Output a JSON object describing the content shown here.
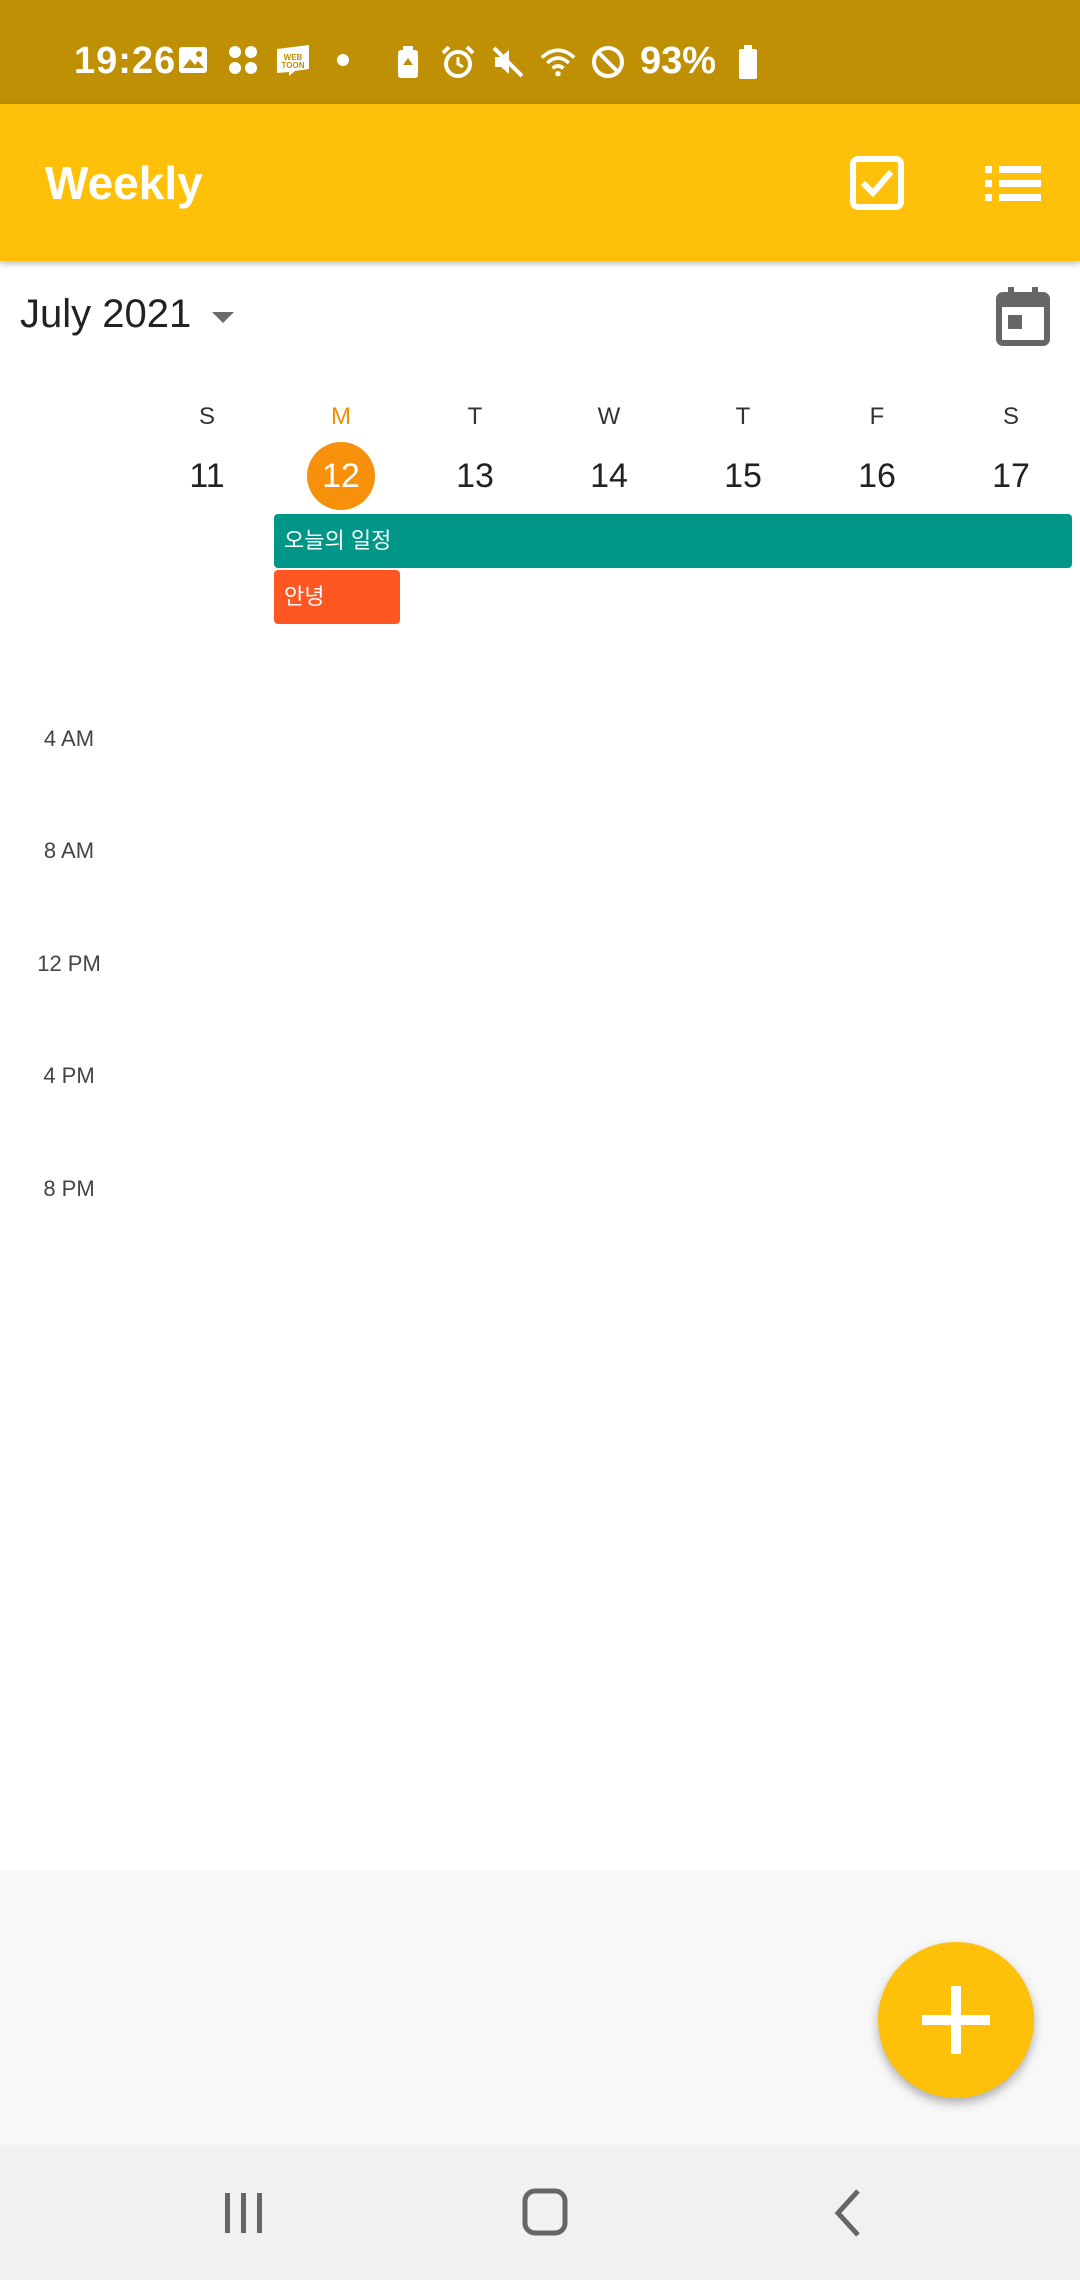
{
  "status_bar": {
    "time": "19:26",
    "battery": "93%",
    "icons": [
      "gallery-icon",
      "app-icon",
      "webtoon-icon",
      "dot-icon",
      "battery-saver-icon",
      "alarm-icon",
      "mute-icon",
      "wifi-icon",
      "do-not-disturb-icon",
      "battery-icon"
    ]
  },
  "app_bar": {
    "title": "Weekly",
    "actions": [
      "check-box-icon",
      "list-icon"
    ]
  },
  "header": {
    "month": "July 2021"
  },
  "week": {
    "days": [
      {
        "letter": "S",
        "number": "11"
      },
      {
        "letter": "M",
        "number": "12",
        "today": true
      },
      {
        "letter": "T",
        "number": "13"
      },
      {
        "letter": "W",
        "number": "14"
      },
      {
        "letter": "T",
        "number": "15"
      },
      {
        "letter": "F",
        "number": "16"
      },
      {
        "letter": "S",
        "number": "17"
      }
    ]
  },
  "events": [
    {
      "title": "오늘의 일정",
      "color": "#009688"
    },
    {
      "title": "안녕",
      "color": "#ff5722"
    }
  ],
  "time_labels": [
    "4 AM",
    "8 AM",
    "12 PM",
    "4 PM",
    "8 PM"
  ],
  "colors": {
    "status_bar": "#bf8f04",
    "app_bar": "#fec008",
    "today": "#f7900a"
  }
}
